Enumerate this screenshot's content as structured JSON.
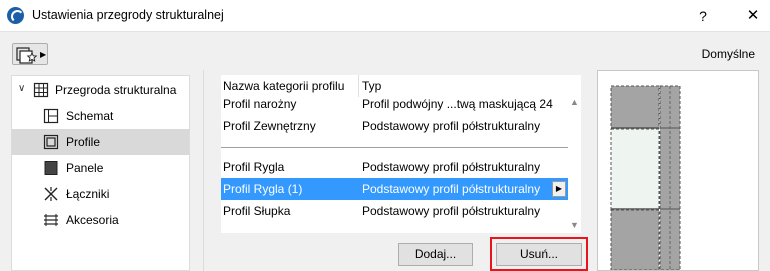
{
  "window": {
    "title": "Ustawienia przegrody strukturalnej",
    "help_label": "?",
    "close_label": "✕"
  },
  "toolbar": {
    "favorites_icon": "favorites-icon",
    "defaults_label": "Domyślne"
  },
  "tree": {
    "root": {
      "label": "Przegroda strukturalna",
      "icon": "curtain-wall-icon",
      "expanded": true
    },
    "items": [
      {
        "label": "Schemat",
        "icon": "scheme-icon",
        "selected": false
      },
      {
        "label": "Profile",
        "icon": "profile-icon",
        "selected": true
      },
      {
        "label": "Panele",
        "icon": "panel-icon",
        "selected": false
      },
      {
        "label": "Łączniki",
        "icon": "junction-icon",
        "selected": false
      },
      {
        "label": "Akcesoria",
        "icon": "accessory-icon",
        "selected": false
      }
    ]
  },
  "profile_list": {
    "header": {
      "col1": "Nazwa kategorii profilu",
      "col2": "Typ"
    },
    "group1": [
      {
        "name": "Profil narożny",
        "type": "Profil podwójny ...twą maskującą 24"
      },
      {
        "name": "Profil Zewnętrzny",
        "type": "Podstawowy profil półstrukturalny"
      }
    ],
    "group2": [
      {
        "name": "Profil Rygla",
        "type": "Podstawowy profil półstrukturalny"
      },
      {
        "name": "Profil Rygla (1)",
        "type": "Podstawowy profil półstrukturalny",
        "selected": true
      },
      {
        "name": "Profil Słupka",
        "type": "Podstawowy profil półstrukturalny"
      }
    ]
  },
  "buttons": {
    "add_label": "Dodaj...",
    "delete_label": "Usuń..."
  },
  "colors": {
    "selection": "#3399ff",
    "highlight": "#e8151b"
  }
}
